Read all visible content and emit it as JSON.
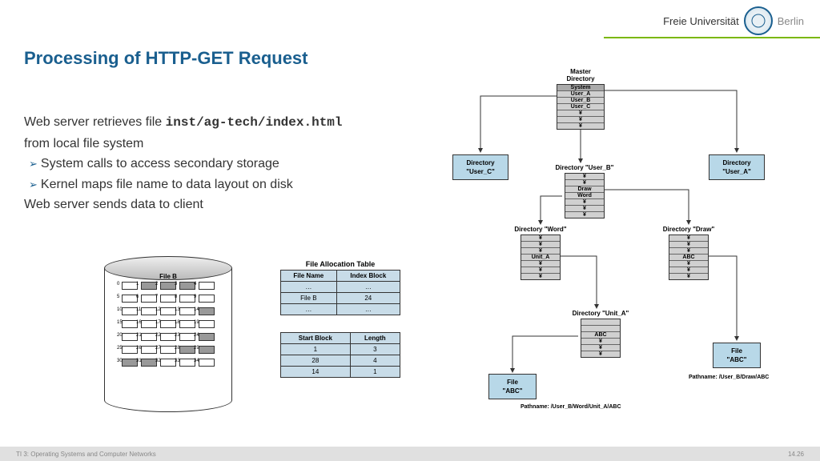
{
  "header": {
    "uni_left": "Freie Universität",
    "uni_right": "Berlin"
  },
  "title": "Processing of HTTP-GET Request",
  "body": {
    "line1a": "Web server retrieves file ",
    "line1_mono": "inst/ag-tech/index.html",
    "line1b": " from local file system",
    "bullet1": "System calls to access secondary storage",
    "bullet2": "Kernel maps file name to data layout on disk",
    "line2": "Web server sends data to client"
  },
  "disk": {
    "label": "File B",
    "blocks": [
      [
        {
          "n": "0"
        },
        {
          "n": "1",
          "f": true
        },
        {
          "n": "2",
          "f": true
        },
        {
          "n": "3",
          "f": true
        },
        {
          "n": "4"
        }
      ],
      [
        {
          "n": "5"
        },
        {
          "n": "6"
        },
        {
          "n": "7"
        },
        {
          "n": "8"
        },
        {
          "n": "9"
        }
      ],
      [
        {
          "n": "10"
        },
        {
          "n": "11"
        },
        {
          "n": "12"
        },
        {
          "n": "13"
        },
        {
          "n": "14",
          "f": true
        }
      ],
      [
        {
          "n": "15"
        },
        {
          "n": "16"
        },
        {
          "n": "17"
        },
        {
          "n": "18"
        },
        {
          "n": "19"
        }
      ],
      [
        {
          "n": "20"
        },
        {
          "n": "21"
        },
        {
          "n": "22"
        },
        {
          "n": "23"
        },
        {
          "n": "24",
          "f": true
        }
      ],
      [
        {
          "n": "25"
        },
        {
          "n": "26"
        },
        {
          "n": "27"
        },
        {
          "n": "28",
          "f": true
        },
        {
          "n": "29",
          "f": true
        }
      ],
      [
        {
          "n": "30",
          "f": true
        },
        {
          "n": "31",
          "f": true
        },
        {
          "n": "32"
        },
        {
          "n": "33"
        },
        {
          "n": "34"
        }
      ]
    ]
  },
  "fat": {
    "title": "File Allocation Table",
    "h1": "File Name",
    "h2": "Index Block",
    "rows": [
      [
        "…",
        "…"
      ],
      [
        "File B",
        "24"
      ],
      [
        "…",
        "…"
      ]
    ]
  },
  "blocktab": {
    "h1": "Start Block",
    "h2": "Length",
    "rows": [
      [
        "1",
        "3"
      ],
      [
        "28",
        "4"
      ],
      [
        "14",
        "1"
      ]
    ]
  },
  "tree": {
    "master": "Master Directory",
    "master_items": [
      "System",
      "User_A",
      "User_B",
      "User_C",
      "¥",
      "¥",
      "¥"
    ],
    "dir_c": "Directory\n\"User_C\"",
    "dir_a": "Directory\n\"User_A\"",
    "dir_b": "Directory \"User_B\"",
    "dir_b_items": [
      "¥",
      "¥",
      "Draw",
      "Word",
      "¥",
      "¥",
      "¥"
    ],
    "dir_word": "Directory \"Word\"",
    "dir_word_items": [
      "¥",
      "¥",
      "¥",
      "Unit_A",
      "¥",
      "¥",
      "¥"
    ],
    "dir_draw": "Directory \"Draw\"",
    "dir_draw_items": [
      "¥",
      "¥",
      "¥",
      "ABC",
      "¥",
      "¥",
      "¥"
    ],
    "dir_unit": "Directory \"Unit_A\"",
    "dir_unit_items": [
      "",
      "",
      "ABC",
      "¥",
      "¥",
      "¥"
    ],
    "file_abc1": "File\n\"ABC\"",
    "file_abc2": "File\n\"ABC\"",
    "path1": "Pathname: /User_B/Word/Unit_A/ABC",
    "path2": "Pathname: /User_B/Draw/ABC"
  },
  "footer": {
    "left": "TI 3: Operating Systems and Computer Networks",
    "right": "14.26"
  }
}
